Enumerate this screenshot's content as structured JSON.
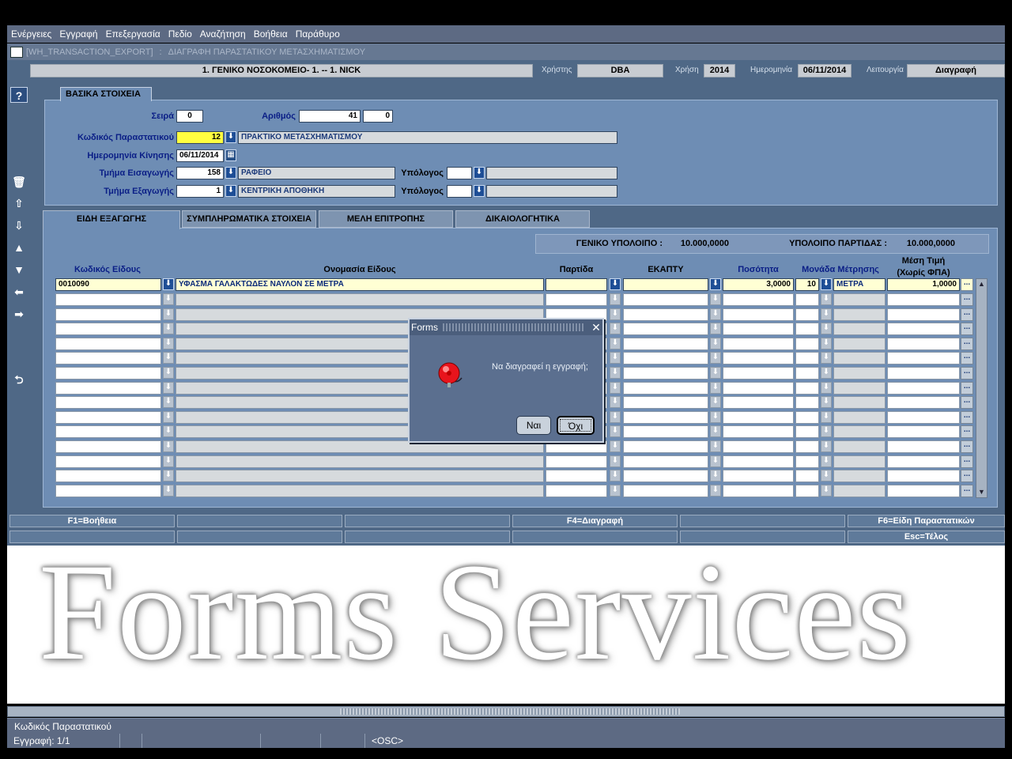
{
  "menu": [
    "Ενέργειες",
    "Εγγραφή",
    "Επεξεργασία",
    "Πεδίο",
    "Αναζήτηση",
    "Βοήθεια",
    "Παράθυρο"
  ],
  "window": {
    "module": "[WH_TRANSACTION_EXPORT]",
    "separator": ":",
    "title": "ΔΙΑΓΡΑΦΗ ΠΑΡΑΣΤΑΤΙΚΟΥ ΜΕΤΑΣΧΗΜΑΤΙΣΜΟΥ"
  },
  "header": {
    "org": "1. ΓΕΝΙΚΟ ΝΟΣΟΚΟΜΕΙΟ- 1. -- 1. NICK",
    "user_label": "Χρήστης",
    "user": "DBA",
    "year_label": "Χρήση",
    "year": "2014",
    "date_label": "Ημερομηνία",
    "date": "06/11/2014",
    "function_label": "Λειτουργία",
    "function": "Διαγραφή"
  },
  "basic": {
    "section_title": "ΒΑΣΙΚΑ ΣΤΟΙΧΕΙΑ",
    "series_label": "Σειρά",
    "series": "0",
    "number_label": "Αριθμός",
    "number": "41",
    "number2": "0",
    "doc_code_label": "Κωδικός Παραστατικού",
    "doc_code": "12",
    "doc_desc": "ΠΡΑΚΤΙΚΟ ΜΕΤΑΣΧΗΜΑΤΙΣΜΟΥ",
    "move_date_label": "Ημερομηνία Κίνησης",
    "move_date": "06/11/2014",
    "import_dept_label": "Τμήμα Εισαγωγής",
    "import_dept_code": "158",
    "import_dept_desc": "ΡΑΦΕΙΟ",
    "responsible_label": "Υπόλογος",
    "export_dept_label": "Τμήμα Εξαγωγής",
    "export_dept_code": "1",
    "export_dept_desc": "ΚΕΝΤΡΙΚΗ ΑΠΟΘΗΚΗ",
    "responsible2_label": "Υπόλογος"
  },
  "tabs": [
    "ΕΙΔΗ ΕΞΑΓΩΓΗΣ",
    "ΣΥΜΠΛΗΡΩΜΑΤΙΚΑ ΣΤΟΙΧΕΙΑ",
    "ΜΕΛΗ ΕΠΙΤΡΟΠΗΣ",
    "ΔΙΚΑΙΟΛΟΓΗΤΙΚΑ"
  ],
  "balances": {
    "general_label": "ΓΕΝΙΚΟ ΥΠΟΛΟΙΠΟ :",
    "general": "10.000,0000",
    "batch_label": "ΥΠΟΛΟΙΠΟ ΠΑΡΤΙΔΑΣ :",
    "batch": "10.000,0000"
  },
  "columns": {
    "code": "Κωδικός Είδους",
    "name": "Ονομασία Είδους",
    "batch": "Παρτίδα",
    "ekapty": "ΕΚΑΠΤΥ",
    "qty": "Ποσότητα",
    "unit": "Μονάδα Μέτρησης",
    "avg1": "Μέση Τιμή",
    "avg2": "(Χωρίς ΦΠΑ)"
  },
  "row1": {
    "code": "0010090",
    "name": "ΥΦΑΣΜΑ ΓΑΛΑΚΤΩΔΕΣ ΝΑΥΛΟΝ ΣΕ ΜΕΤΡΑ",
    "qty": "3,0000",
    "unit_code": "10",
    "unit": "ΜΕΤΡΑ",
    "avg": "1,0000",
    "more": "..."
  },
  "fkeys": {
    "f1": "F1=Βοήθεια",
    "f4": "F4=Διαγραφή",
    "f6": "F6=Είδη Παραστατικών",
    "esc": "Esc=Τέλος"
  },
  "dialog": {
    "title": "Forms",
    "message": "Να διαγραφεί η εγγραφή;",
    "yes": "Ναι",
    "no": "Όχι"
  },
  "watermark": "Forms Services",
  "status": {
    "field": "Κωδικός Παραστατικού",
    "record": "Εγγραφή: 1/1",
    "osc": "<OSC>"
  }
}
